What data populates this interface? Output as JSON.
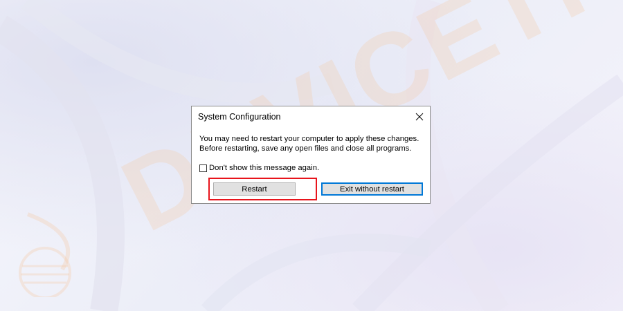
{
  "dialog": {
    "title": "System Configuration",
    "message_line1": "You may need to restart your computer to apply these changes.",
    "message_line2": "Before restarting, save any open files and close all programs.",
    "checkbox_label": "Don't show this message again.",
    "checkbox_checked": false,
    "restart_label": "Restart",
    "exit_label": "Exit without restart",
    "close_icon": "close-icon"
  },
  "watermark": {
    "text": "DEVICETRICKS",
    "logo_icon": "globe-logo"
  },
  "colors": {
    "highlight": "#e8141c",
    "focus_border": "#0078d7",
    "button_face": "#e1e1e1"
  }
}
